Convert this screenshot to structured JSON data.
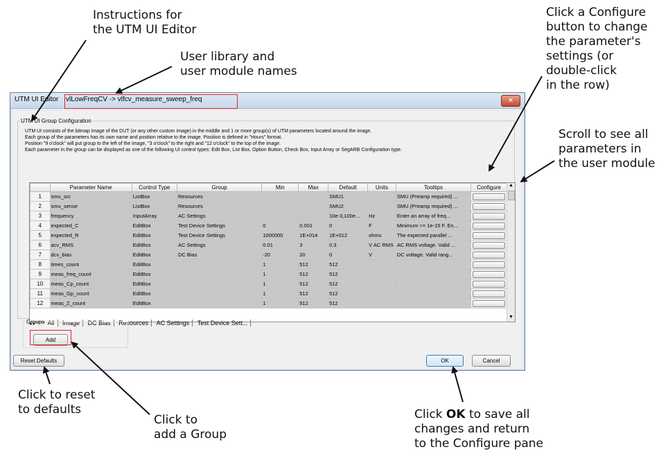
{
  "callouts": {
    "instructions": [
      "Instructions for",
      "the UTM UI Editor"
    ],
    "names": [
      "User library and",
      "user module names"
    ],
    "configure": [
      "Click a Configure",
      "button to change",
      "the parameter's",
      "settings (or",
      "double-click",
      "in the row)"
    ],
    "scroll": [
      "Scroll to see all",
      "parameters in",
      "the user module"
    ],
    "reset": [
      "Click to reset",
      "to defaults"
    ],
    "add": [
      "Click to",
      "add a Group"
    ],
    "ok": {
      "prefix": "Click ",
      "bold": "OK",
      "suffix": " to save all",
      "line2": "changes and return",
      "line3": "to the Configure pane"
    }
  },
  "window": {
    "title": "UTM UI Editor",
    "module_path": "vlLowFreqCV -> vlfcv_measure_sweep_freq",
    "close_glyph": "✕"
  },
  "config": {
    "legend": "UTM UI Group Configuration",
    "instructions": [
      "UTM UI consists of the bitmap image of the DUT (or any other custom image) in the middle and 1 or more group(s) of UTM parameters located around the image.",
      "Each group of the parameters has its own name and position relative to the image. Position is defined in \"Hours\" format.",
      "Position \"9 o'clock\" will put group to the left of the image, \"3 o'clock\" to the right and \"12 o'clock\" to the top of the image.",
      "Each parameter in the group can be displayed as one of the following UI control types: Edit Box, List Box, Option Button, Check Box, Input Array or SegARB Configuration type."
    ]
  },
  "table": {
    "headers": [
      "",
      "Parameter Name",
      "Control Type",
      "Group",
      "Min",
      "Max",
      "Default",
      "Units",
      "Tooltips",
      "Configure"
    ],
    "rows": [
      [
        "1",
        "smu_src",
        "ListBox",
        "Resources",
        "",
        "",
        "SMU1",
        "",
        "SMU (Preamp required) ..."
      ],
      [
        "2",
        "smu_sense",
        "ListBox",
        "Resources",
        "",
        "",
        "SMU2",
        "",
        "SMU (Preamp required) ..."
      ],
      [
        "3",
        "frequency",
        "InputArray",
        "AC Settings",
        "",
        "",
        "10e-3,100e...",
        "Hz",
        "Enter an array of freq..."
      ],
      [
        "4",
        "expected_C",
        "EditBox",
        "Test Device Settings",
        "0",
        "0.001",
        "0",
        "F",
        "Minimum >= 1e-15 F. En..."
      ],
      [
        "5",
        "expected_R",
        "EditBox",
        "Test Device Settings",
        "1000000",
        "1E+014",
        "1E+012",
        "ohms",
        "The expected parallel ..."
      ],
      [
        "6",
        "acv_RMS",
        "EditBox",
        "AC Settings",
        "0.01",
        "3",
        "0.3",
        "V AC RMS",
        "AC RMS voltage. Valid ..."
      ],
      [
        "7",
        "dcv_bias",
        "EditBox",
        "DC Bias",
        "-20",
        "20",
        "0",
        "V",
        "DC voltage. Valid rang..."
      ],
      [
        "8",
        "times_count",
        "EditBox",
        "",
        "1",
        "512",
        "512",
        "",
        ""
      ],
      [
        "9",
        "meas_freq_count",
        "EditBox",
        "",
        "1",
        "512",
        "512",
        "",
        ""
      ],
      [
        "10",
        "meas_Cp_count",
        "EditBox",
        "",
        "1",
        "512",
        "512",
        "",
        ""
      ],
      [
        "11",
        "meas_Gp_count",
        "EditBox",
        "",
        "1",
        "512",
        "512",
        "",
        ""
      ],
      [
        "12",
        "meas_Z_count",
        "EditBox",
        "",
        "1",
        "512",
        "512",
        "",
        ""
      ]
    ]
  },
  "tabs": {
    "nav": "◂ ▸",
    "items": [
      "All",
      "Image",
      "DC Bias",
      "Resources",
      "AC Settings",
      "Test Device Sett..."
    ]
  },
  "groups": {
    "legend": "Groups",
    "add": "Add"
  },
  "buttons": {
    "reset": "Reset Defaults",
    "ok": "OK",
    "cancel": "Cancel"
  },
  "scroll": {
    "up": "▲",
    "down": "▼"
  },
  "colors": {
    "highlight": "#e3202a",
    "cell": "#c8c8c8",
    "titlebar": "#c8d7ea",
    "ok_border": "#3c7fb1"
  }
}
